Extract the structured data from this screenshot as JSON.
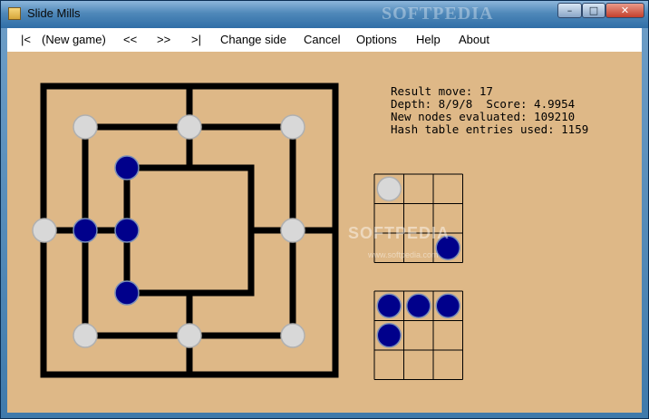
{
  "window": {
    "title": "Slide Mills",
    "watermark": "SOFTPEDIA",
    "buttons": {
      "minimize": "–",
      "maximize": "□",
      "close": "✕"
    }
  },
  "menu": {
    "first": "|<",
    "new_game": "(New game)",
    "back": "<<",
    "forward": ">>",
    "last": ">|",
    "change_side": "Change side",
    "cancel": "Cancel",
    "options": "Options",
    "help": "Help",
    "about": "About"
  },
  "info": {
    "result_move": "Result move: 17",
    "depth_score": "Depth: 8/9/8  Score: 4.9954",
    "nodes": "New nodes evaluated: 109210",
    "hash": "Hash table entries used: 1159"
  },
  "overlay_watermark": {
    "brand": "SOFTPEDIA",
    "url": "www.softpedia.com"
  },
  "colors": {
    "background": "#deb887",
    "line": "#000000",
    "white_piece": "#d8d8d8",
    "blue_piece": "#00008b"
  },
  "board": {
    "note": "Nine Men's Morris points indexed by ring (0 outer,1 middle,2 inner) and position 0-7 clockwise from top-left",
    "pieces": [
      {
        "ring": 1,
        "pos": 0,
        "color": "white"
      },
      {
        "ring": 1,
        "pos": 1,
        "color": "white"
      },
      {
        "ring": 1,
        "pos": 2,
        "color": "white"
      },
      {
        "ring": 1,
        "pos": 3,
        "color": "white"
      },
      {
        "ring": 1,
        "pos": 4,
        "color": "white"
      },
      {
        "ring": 1,
        "pos": 5,
        "color": "white"
      },
      {
        "ring": 1,
        "pos": 6,
        "color": "white"
      },
      {
        "ring": 0,
        "pos": 7,
        "color": "white"
      },
      {
        "ring": 1,
        "pos": 7,
        "color": "blue"
      },
      {
        "ring": 2,
        "pos": 0,
        "color": "blue"
      },
      {
        "ring": 2,
        "pos": 7,
        "color": "blue"
      },
      {
        "ring": 2,
        "pos": 6,
        "color": "blue"
      }
    ]
  },
  "reserve_white": {
    "cells": [
      1,
      0,
      0,
      0,
      0,
      0,
      0,
      0,
      0
    ]
  },
  "reserve_blue_top": {
    "cells": [
      0,
      0,
      0,
      0,
      0,
      0,
      0,
      0,
      1
    ]
  },
  "reserve_blue": {
    "cells": [
      1,
      1,
      1,
      1,
      0,
      0,
      0,
      0,
      0
    ]
  }
}
